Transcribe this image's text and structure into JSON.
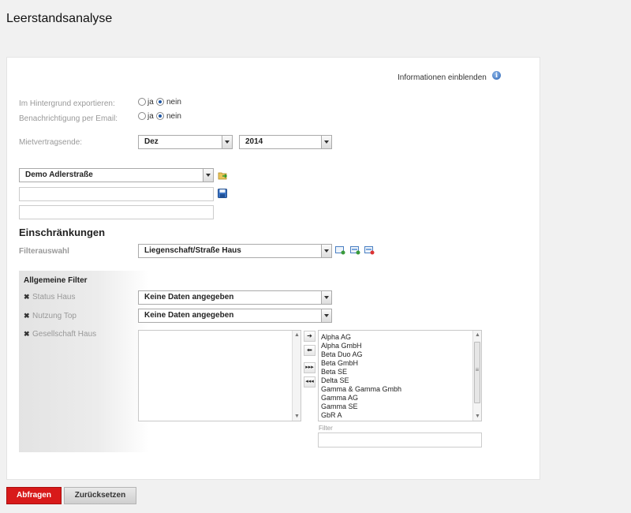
{
  "page": {
    "title": "Leerstandsanalyse"
  },
  "info": {
    "label": "Informationen einblenden",
    "icon": "info-icon"
  },
  "options": {
    "export_label": "Im Hintergrund exportieren:",
    "email_label": "Benachrichtigung per Email:",
    "yes": "ja",
    "no": "nein",
    "export_selected": "nein",
    "email_selected": "nein"
  },
  "contract_end": {
    "label": "Mietvertragsende:",
    "month": "Dez",
    "year": "2014"
  },
  "template": {
    "selected": "Demo Adlerstraße",
    "name_value": "",
    "description_value": ""
  },
  "restrictions": {
    "title": "Einschränkungen",
    "filter_label": "Filterauswahl",
    "filter_selected": "Liegenschaft/Straße Haus"
  },
  "general_filter": {
    "title": "Allgemeine Filter",
    "status_label": "Status Haus",
    "status_value": "Keine Daten angegeben",
    "usage_label": "Nutzung Top",
    "usage_value": "Keine Daten angegeben",
    "company_label": "Gesellschaft Haus",
    "available": [
      "Alpha AG",
      "Alpha GmbH",
      "Beta Duo AG",
      "Beta GmbH",
      "Beta SE",
      "Delta SE",
      "Gamma & Gamma Gmbh",
      "Gamma AG",
      "Gamma SE",
      "GbR A"
    ],
    "filter_label": "Filter",
    "filter_value": ""
  },
  "buttons": {
    "query": "Abfragen",
    "reset": "Zurücksetzen"
  },
  "colors": {
    "primary": "#d81a1a",
    "radio_accent": "#1d55a3"
  }
}
